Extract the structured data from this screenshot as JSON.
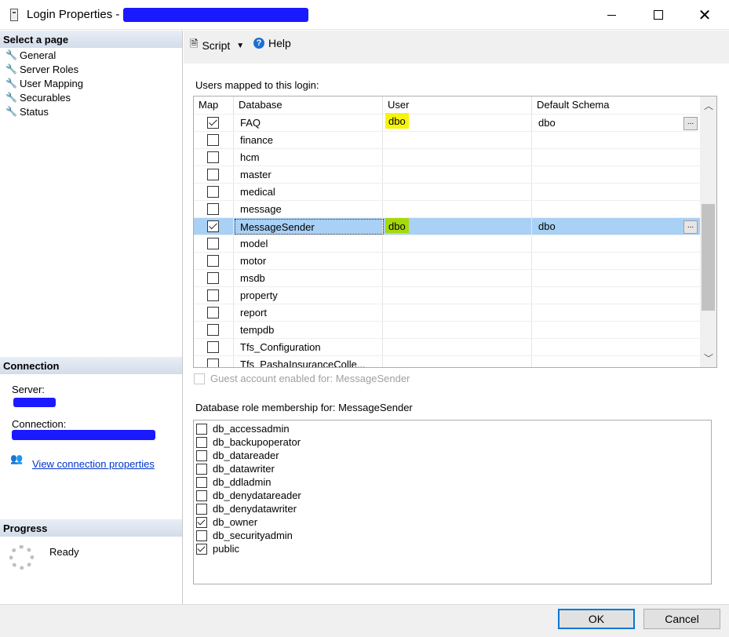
{
  "window": {
    "title": "Login Properties - ",
    "minimize_icon": "minimize-icon",
    "maximize_icon": "maximize-icon",
    "close_glyph": "✕"
  },
  "left": {
    "select_page_header": "Select a page",
    "pages": [
      {
        "label": "General",
        "icon": "wrench-icon"
      },
      {
        "label": "Server Roles",
        "icon": "wrench-icon"
      },
      {
        "label": "User Mapping",
        "icon": "wrench-icon"
      },
      {
        "label": "Securables",
        "icon": "wrench-icon"
      },
      {
        "label": "Status",
        "icon": "wrench-icon"
      }
    ],
    "connection_header": "Connection",
    "server_label": "Server:",
    "connection_label": "Connection:",
    "view_connection_link": "View connection properties",
    "progress_header": "Progress",
    "progress_status": "Ready"
  },
  "toolbar": {
    "script_label": "Script",
    "help_label": "Help"
  },
  "mapping": {
    "label": "Users mapped to this login:",
    "columns": [
      "Map",
      "Database",
      "User",
      "Default Schema"
    ],
    "rows": [
      {
        "map": true,
        "database": "FAQ",
        "user": "dbo",
        "schema": "dbo"
      },
      {
        "map": false,
        "database": "finance",
        "user": "",
        "schema": ""
      },
      {
        "map": false,
        "database": "hcm",
        "user": "",
        "schema": ""
      },
      {
        "map": false,
        "database": "master",
        "user": "",
        "schema": ""
      },
      {
        "map": false,
        "database": "medical",
        "user": "",
        "schema": ""
      },
      {
        "map": false,
        "database": "message",
        "user": "",
        "schema": ""
      },
      {
        "map": true,
        "database": "MessageSender",
        "user": "dbo",
        "schema": "dbo",
        "selected": true
      },
      {
        "map": false,
        "database": "model",
        "user": "",
        "schema": ""
      },
      {
        "map": false,
        "database": "motor",
        "user": "",
        "schema": ""
      },
      {
        "map": false,
        "database": "msdb",
        "user": "",
        "schema": ""
      },
      {
        "map": false,
        "database": "property",
        "user": "",
        "schema": ""
      },
      {
        "map": false,
        "database": "report",
        "user": "",
        "schema": ""
      },
      {
        "map": false,
        "database": "tempdb",
        "user": "",
        "schema": ""
      },
      {
        "map": false,
        "database": "Tfs_Configuration",
        "user": "",
        "schema": ""
      },
      {
        "map": false,
        "database": "Tfs_PashaInsuranceColle...",
        "user": "",
        "schema": ""
      }
    ],
    "ellipsis": "...",
    "guest_label": "Guest account enabled for: MessageSender"
  },
  "roles": {
    "label": "Database role membership for: MessageSender",
    "items": [
      {
        "label": "db_accessadmin",
        "checked": false
      },
      {
        "label": "db_backupoperator",
        "checked": false
      },
      {
        "label": "db_datareader",
        "checked": false
      },
      {
        "label": "db_datawriter",
        "checked": false
      },
      {
        "label": "db_ddladmin",
        "checked": false
      },
      {
        "label": "db_denydatareader",
        "checked": false
      },
      {
        "label": "db_denydatawriter",
        "checked": false
      },
      {
        "label": "db_owner",
        "checked": true
      },
      {
        "label": "db_securityadmin",
        "checked": false
      },
      {
        "label": "public",
        "checked": true
      }
    ]
  },
  "buttons": {
    "ok": "OK",
    "cancel": "Cancel"
  },
  "colors": {
    "selection": "#a9d0f5",
    "highlight_yellow": "#f5f50a",
    "highlight_green": "#a6d90a",
    "redaction": "#1a1aff",
    "link": "#0033cc"
  }
}
